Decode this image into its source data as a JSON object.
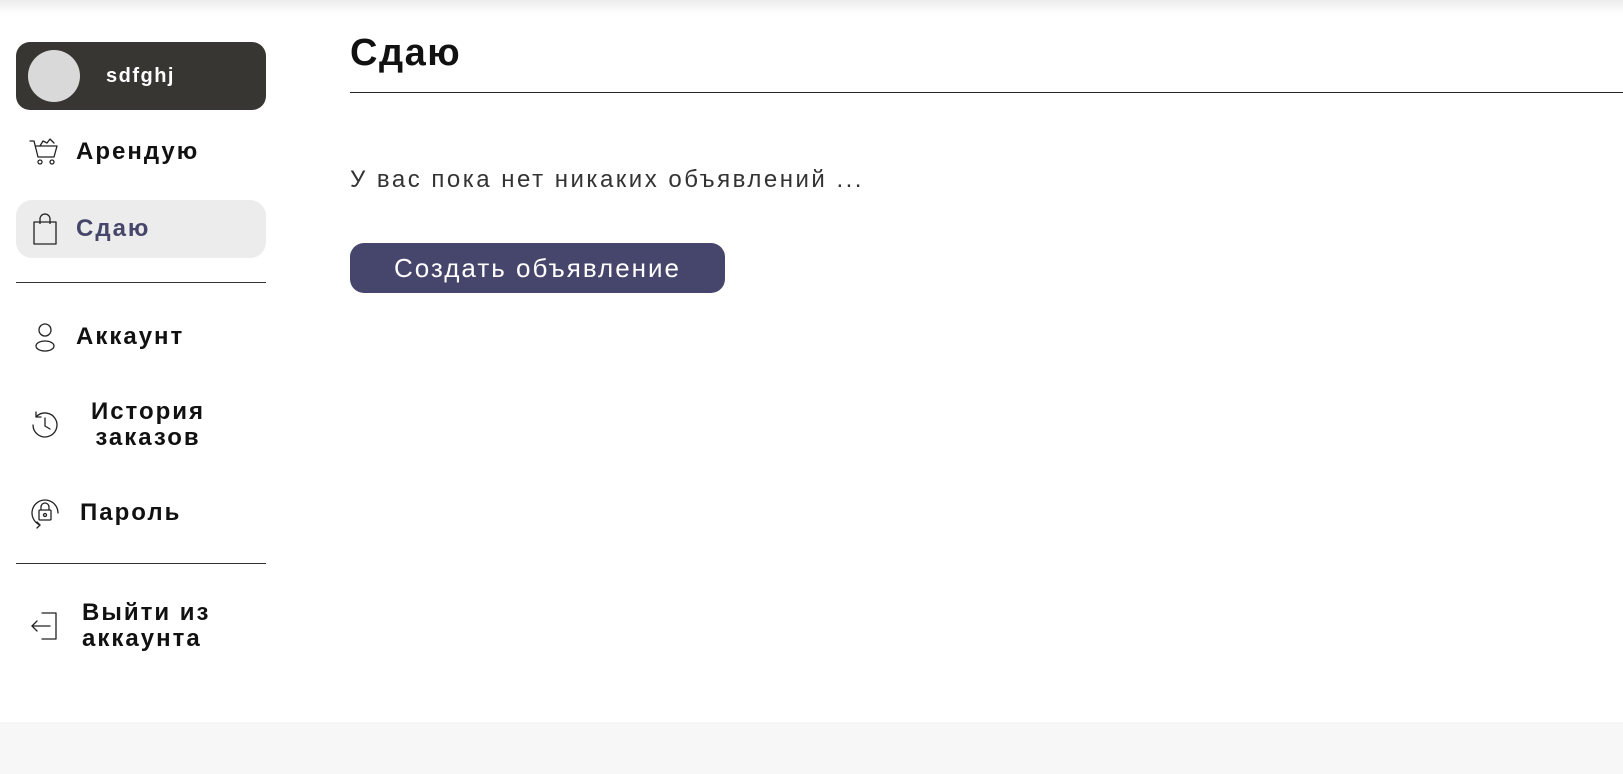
{
  "user": {
    "name": "sdfghj"
  },
  "sidebar": {
    "items": [
      {
        "label": "Арендую",
        "icon": "shopping-cart-icon"
      },
      {
        "label": "Сдаю",
        "icon": "shopping-bag-icon",
        "active": true
      },
      {
        "label": "Аккаунт",
        "icon": "user-icon"
      },
      {
        "label": "История заказов",
        "icon": "history-icon"
      },
      {
        "label": "Пароль",
        "icon": "lock-icon"
      },
      {
        "label": "Выйти из аккаунта",
        "icon": "logout-icon"
      }
    ]
  },
  "main": {
    "title": "Сдаю",
    "empty_message": "У вас пока нет никаких объявлений ...",
    "create_button": "Создать объявление"
  },
  "colors": {
    "accent": "#46456b",
    "user_card": "#383633",
    "active_bg": "#ececec"
  }
}
